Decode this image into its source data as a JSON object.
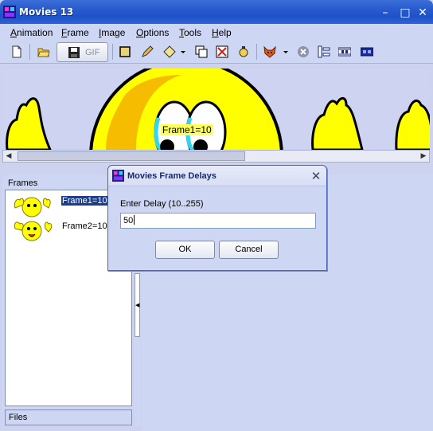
{
  "window": {
    "title": "Movies 13",
    "min_glyph": "–",
    "max_glyph": "□",
    "close_glyph": "✕"
  },
  "menu": [
    "Animation",
    "Frame",
    "Image",
    "Options",
    "Tools",
    "Help"
  ],
  "toolbar": {
    "gif_label": "GIF",
    "icons": [
      "new-file-icon",
      "open-folder-icon",
      "save-gif-icon",
      "rectangle-icon",
      "pencil-icon",
      "diamond-icon",
      "dropdown-arrow-icon",
      "copy-frame-icon",
      "delete-frame-icon",
      "stopwatch-icon",
      "fox-icon",
      "dropdown-arrow-icon",
      "close-circle-icon",
      "align-left-icon",
      "film-strip-icon",
      "film-strip-blue-icon"
    ]
  },
  "canvas": {
    "frame_tip": "Frame1=10"
  },
  "frames_panel": {
    "header": "Frames",
    "items": [
      {
        "label": "Frame1=10",
        "selected": true
      },
      {
        "label": "Frame2=10",
        "selected": false
      }
    ],
    "files_header": "Files"
  },
  "dialog": {
    "title": "Movies Frame Delays",
    "close_glyph": "✕",
    "prompt": "Enter Delay (10..255)",
    "input_value": "50",
    "ok_label": "OK",
    "cancel_label": "Cancel"
  },
  "colors": {
    "titlebar": "#2a5ccf",
    "panel": "#cdd6f2",
    "selection": "#1d3e8a",
    "smiley": "#ffff00"
  }
}
